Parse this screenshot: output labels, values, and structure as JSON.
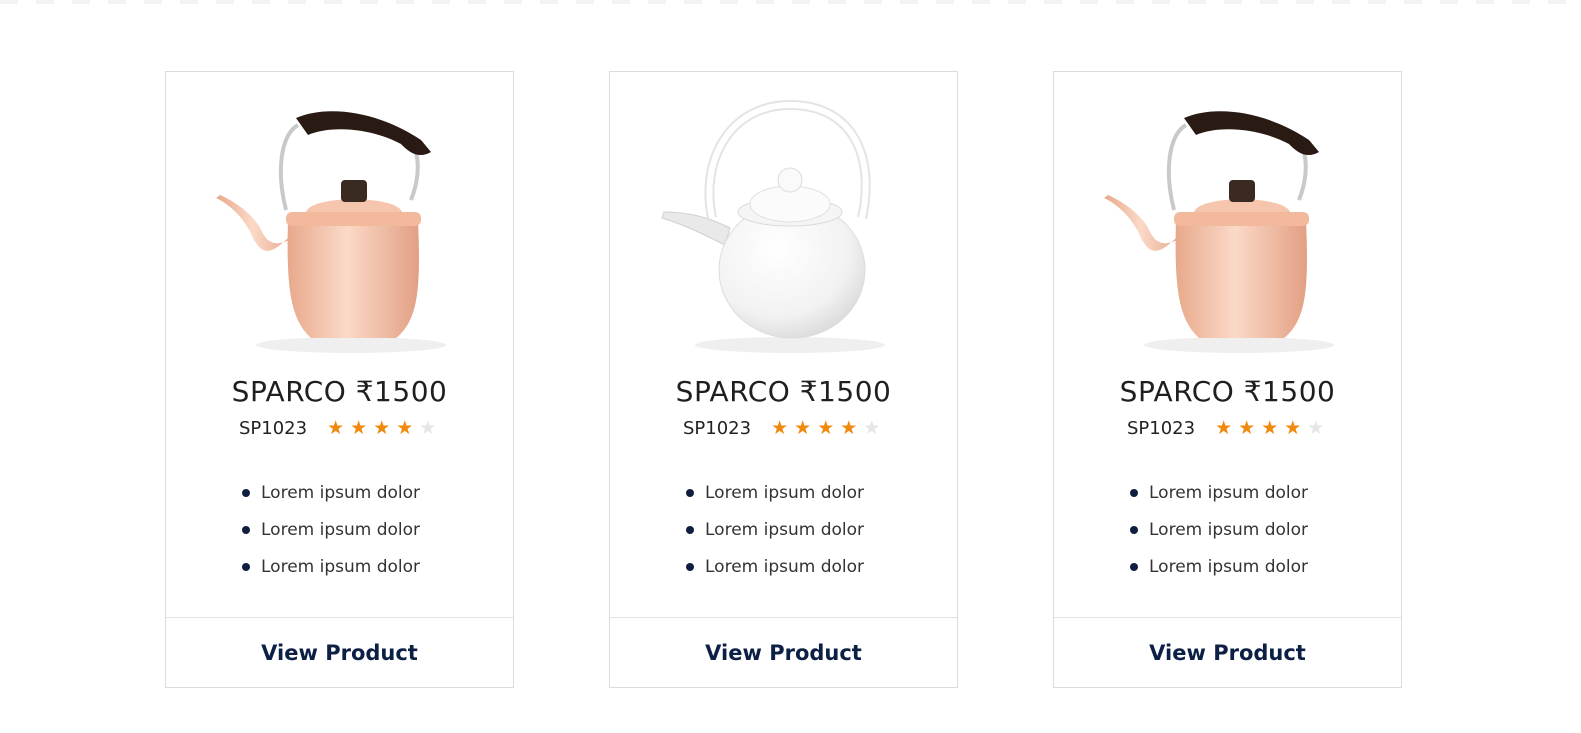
{
  "colors": {
    "accent": "#0c1f45",
    "star_filled": "#ef8a0f",
    "star_empty": "#e6e6e6",
    "border": "#dcdcdc"
  },
  "products": [
    {
      "image_icon": "copper-kettle-image",
      "title": "SPARCO ₹1500",
      "sku": "SP1023",
      "rating": 4,
      "rating_max": 5,
      "features": [
        "Lorem ipsum dolor",
        "Lorem ipsum dolor",
        "Lorem ipsum dolor"
      ],
      "button_label": "View Product"
    },
    {
      "image_icon": "white-kettle-image",
      "title": "SPARCO ₹1500",
      "sku": "SP1023",
      "rating": 4,
      "rating_max": 5,
      "features": [
        "Lorem ipsum dolor",
        "Lorem ipsum dolor",
        "Lorem ipsum dolor"
      ],
      "button_label": "View Product"
    },
    {
      "image_icon": "copper-kettle-image",
      "title": "SPARCO ₹1500",
      "sku": "SP1023",
      "rating": 4,
      "rating_max": 5,
      "features": [
        "Lorem ipsum dolor",
        "Lorem ipsum dolor",
        "Lorem ipsum dolor"
      ],
      "button_label": "View Product"
    }
  ]
}
